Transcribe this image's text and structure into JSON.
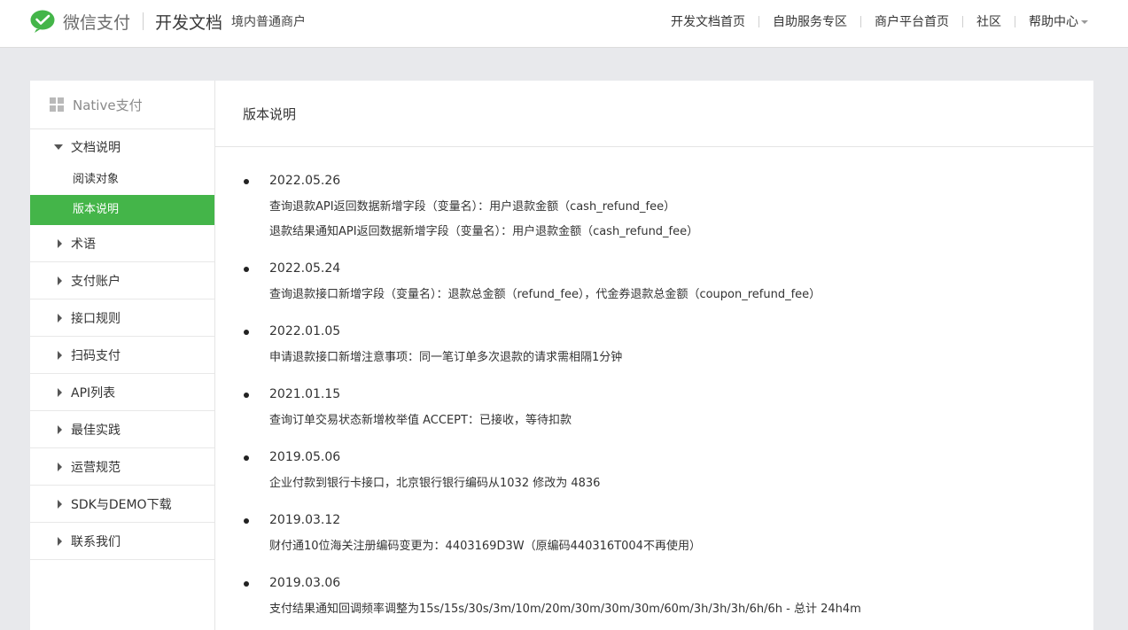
{
  "header": {
    "brand": "微信支付",
    "doc_title": "开发文档",
    "subtitle": "境内普通商户",
    "nav": [
      "开发文档首页",
      "自助服务专区",
      "商户平台首页",
      "社区",
      "帮助中心"
    ]
  },
  "sidebar": {
    "title": "Native支付",
    "open_group": {
      "label": "文档说明",
      "items": [
        {
          "label": "阅读对象",
          "active": false
        },
        {
          "label": "版本说明",
          "active": true
        }
      ]
    },
    "items": [
      "术语",
      "支付账户",
      "接口规则",
      "扫码支付",
      "API列表",
      "最佳实践",
      "运营规范",
      "SDK与DEMO下载",
      "联系我们"
    ]
  },
  "main": {
    "title": "版本说明",
    "entries": [
      {
        "date": "2022.05.26",
        "lines": [
          "查询退款API返回数据新增字段（变量名）：用户退款金额（cash_refund_fee）",
          "退款结果通知API返回数据新增字段（变量名）：用户退款金额（cash_refund_fee）"
        ]
      },
      {
        "date": "2022.05.24",
        "lines": [
          "查询退款接口新增字段（变量名）：退款总金额（refund_fee），代金券退款总金额（coupon_refund_fee）"
        ]
      },
      {
        "date": "2022.01.05",
        "lines": [
          "申请退款接口新增注意事项：同一笔订单多次退款的请求需相隔1分钟"
        ]
      },
      {
        "date": "2021.01.15",
        "lines": [
          "查询订单交易状态新增枚举值 ACCEPT：已接收，等待扣款"
        ]
      },
      {
        "date": "2019.05.06",
        "lines": [
          "企业付款到银行卡接口，北京银行银行编码从1032 修改为 4836"
        ]
      },
      {
        "date": "2019.03.12",
        "lines": [
          "财付通10位海关注册编码变更为：4403169D3W（原编码440316T004不再使用）"
        ]
      },
      {
        "date": "2019.03.06",
        "lines": [
          "支付结果通知回调频率调整为15s/15s/30s/3m/10m/20m/30m/30m/30m/60m/3h/3h/3h/6h/6h - 总计 24h4m"
        ]
      }
    ]
  },
  "colors": {
    "accent": "#44b549",
    "logo": "#44b549"
  }
}
